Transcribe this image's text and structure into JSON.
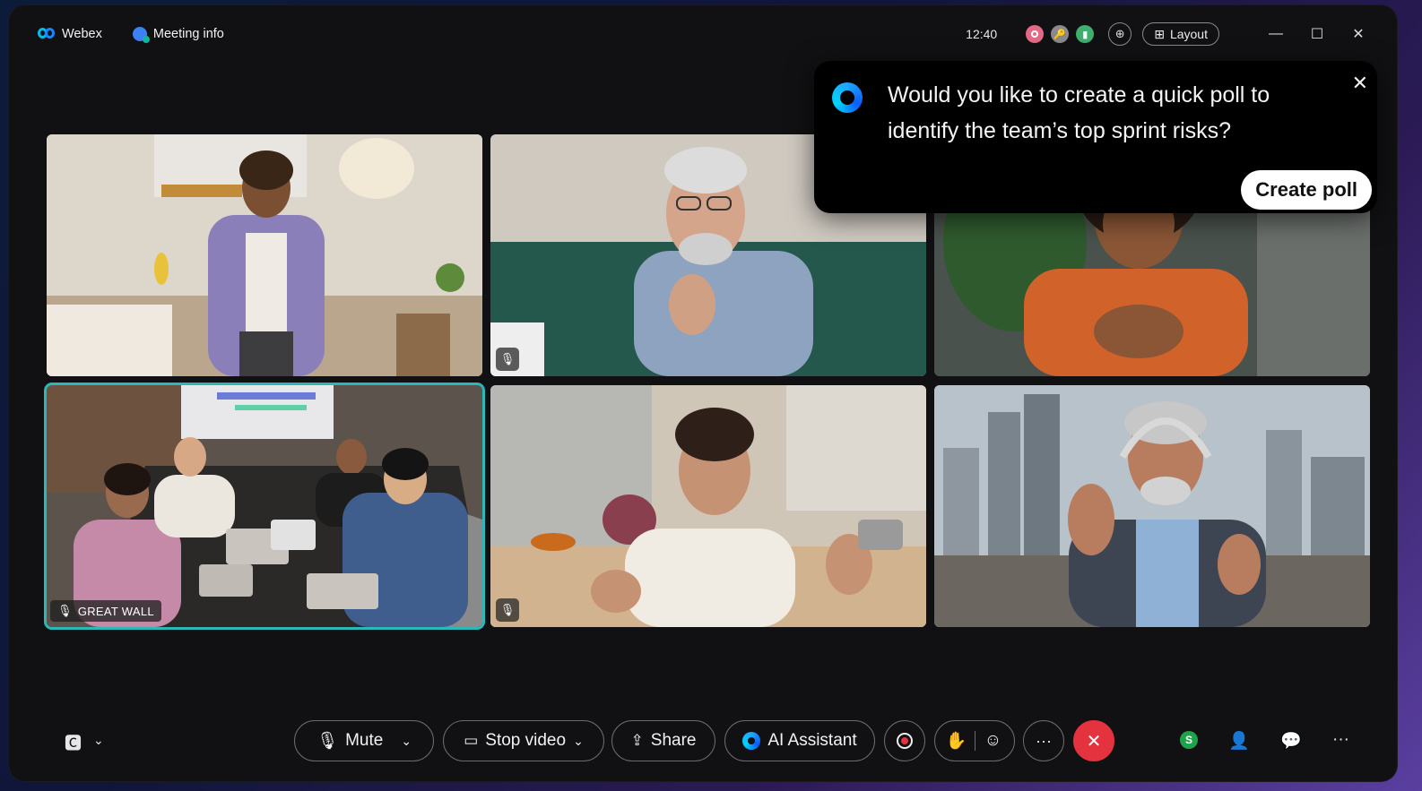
{
  "titlebar": {
    "app_name": "Webex",
    "meeting_info": "Meeting info",
    "clock": "12:40",
    "layout_label": "Layout"
  },
  "poll_prompt": {
    "question": "Would you like to create a quick poll to identify the team’s top sprint risks?",
    "button": "Create poll"
  },
  "tiles": [
    {
      "id": "woman-purple-shirt",
      "muted": false
    },
    {
      "id": "older-man-glasses",
      "muted": true
    },
    {
      "id": "woman-orange-top",
      "muted": false
    },
    {
      "id": "great-wall-room",
      "label": "GREAT WALL",
      "active": true
    },
    {
      "id": "woman-kitchen",
      "muted": true
    },
    {
      "id": "man-headphones",
      "muted": false
    }
  ],
  "controls": {
    "mute": "Mute",
    "stop_video": "Stop video",
    "share": "Share",
    "ai_assistant": "AI Assistant",
    "avatar_initial": "S"
  },
  "colors": {
    "active_speaker": "#2bb8b8",
    "end_call": "#e4333f",
    "avatar": "#1ea34a"
  }
}
